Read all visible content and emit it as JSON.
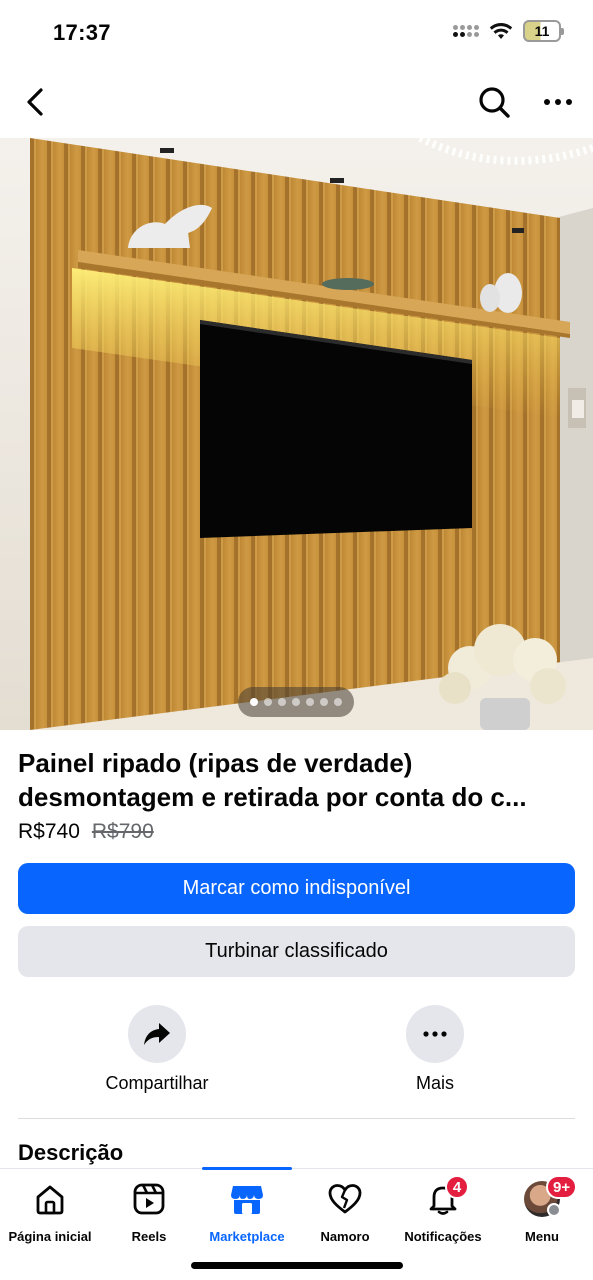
{
  "status_bar": {
    "time": "17:37",
    "battery": "11"
  },
  "nav": {
    "back_icon": "chevron-left-icon",
    "search_icon": "search-icon",
    "more_icon": "more-horizontal-icon"
  },
  "hero": {
    "image_description_icon": "product-photo",
    "dots_total": 7,
    "dots_active_index": 0
  },
  "listing": {
    "title_line1": "Painel ripado (ripas de verdade)",
    "title_line2": "desmontagem e retirada por conta do c...",
    "price": "R$740",
    "old_price": "R$790"
  },
  "buttons": {
    "mark_unavailable": "Marcar como indisponível",
    "boost": "Turbinar classificado"
  },
  "actions": {
    "share_label": "Compartilhar",
    "more_label": "Mais"
  },
  "description": {
    "heading": "Descrição"
  },
  "tabbar": {
    "items": [
      {
        "label": "Página inicial",
        "icon": "home-icon"
      },
      {
        "label": "Reels",
        "icon": "reels-icon"
      },
      {
        "label": "Marketplace",
        "icon": "marketplace-icon"
      },
      {
        "label": "Namoro",
        "icon": "dating-heart-icon"
      },
      {
        "label": "Notificações",
        "icon": "bell-icon"
      },
      {
        "label": "Menu",
        "icon": "avatar"
      }
    ],
    "active_index": 2,
    "notif_badge": "4",
    "menu_badge": "9+"
  },
  "colors": {
    "accent": "#0866ff",
    "badge": "#e41e3f",
    "secondary_button": "#e4e6eb"
  }
}
